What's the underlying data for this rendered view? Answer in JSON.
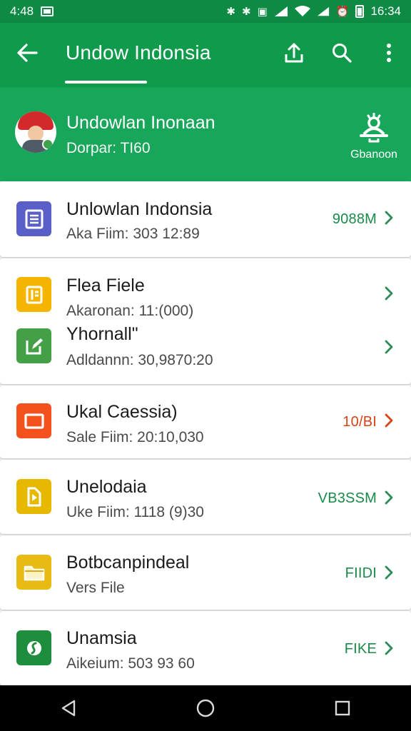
{
  "status_bar": {
    "time": "4:48",
    "clock": "16:34",
    "icons": [
      "photo-notification-icon",
      "bluetooth-icon",
      "bluetooth-icon",
      "vibrate-icon",
      "signal-icon",
      "wifi-icon",
      "signal-icon",
      "alarm-icon",
      "battery-icon"
    ]
  },
  "app_bar": {
    "title": "Undow Indonsia",
    "icons": [
      "back-arrow-icon",
      "share-upload-icon",
      "search-icon",
      "more-vert-icon"
    ]
  },
  "profile": {
    "name": "Undowlan Inonaan",
    "subtitle": "Dorpar: TI60",
    "action_label": "Gbanoon",
    "action_icon": "share-person-icon"
  },
  "items": [
    {
      "title": "Unlowlan Indonsia",
      "meta": "Aka Fiim: 303 12:89",
      "value": "9088M",
      "icon": "document-icon",
      "icon_color": "#5a5fc8",
      "value_color": "green"
    },
    {
      "title": "Flea Fiele",
      "meta": "Akaronan: 11:(000)",
      "value": "",
      "icon": "file-icon",
      "icon_color": "#f4b400"
    },
    {
      "title": "Yhornall\"",
      "meta": "Adldannn: 30,9870:20",
      "value": "",
      "icon": "edit-icon",
      "icon_color": "#43a047"
    },
    {
      "title": "Ukal Caessia)",
      "meta": "Sale Fiim: 20:10,030",
      "value": "10/BI",
      "icon": "slides-icon",
      "icon_color": "#f4511e",
      "value_color": "red"
    },
    {
      "title": "Unelodaia",
      "meta": "Uke Fiim: 1118 (9)30",
      "value": "VB3SSM",
      "icon": "play-file-icon",
      "icon_color": "#e6b800",
      "value_color": "green"
    },
    {
      "title": "Botbcanpindeal",
      "meta": "Vers File",
      "value": "FIIDI",
      "icon": "folder-icon",
      "icon_color": "#e8bb14",
      "value_color": "green"
    },
    {
      "title": "Unamsia",
      "meta": "Aikeium: 503 93 60",
      "value": "FIKE",
      "icon": "sheets-icon",
      "icon_color": "#1e8e3e",
      "value_color": "green"
    }
  ],
  "nav_bar": {
    "icons": [
      "back-triangle-icon",
      "home-circle-icon",
      "recents-square-icon"
    ]
  }
}
